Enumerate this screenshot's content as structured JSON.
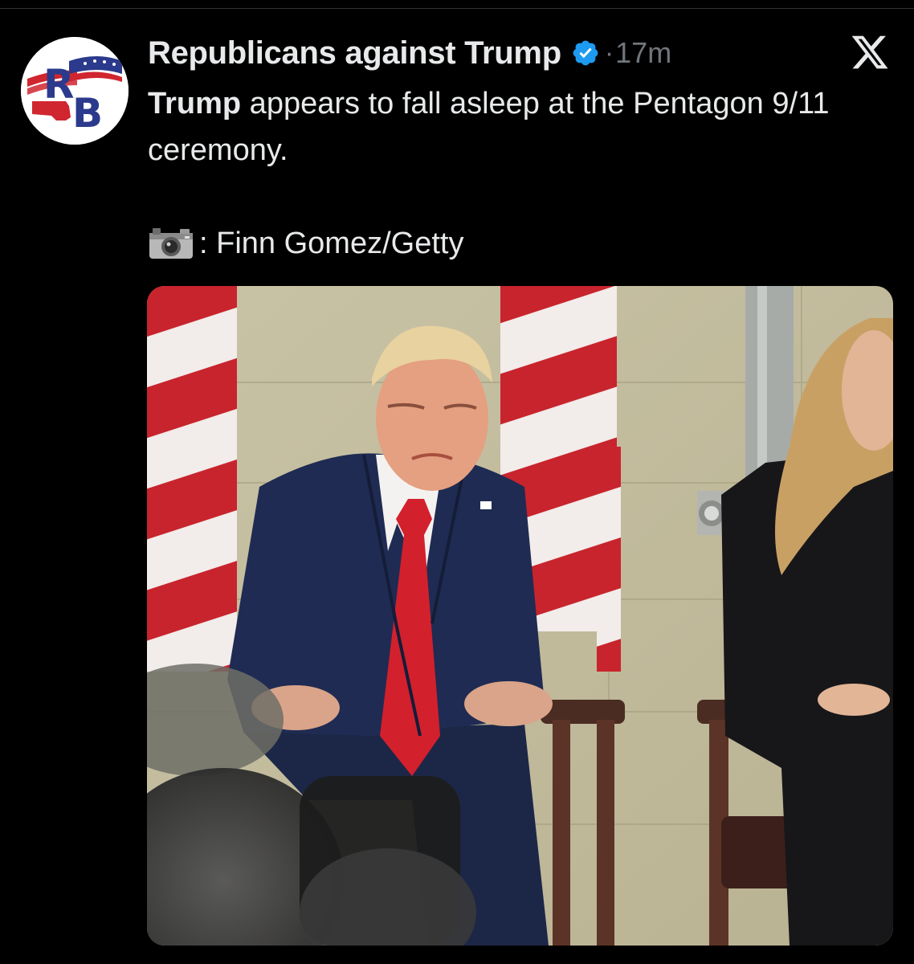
{
  "post": {
    "account_name": "Republicans against Trump",
    "avatar_initials": "RB",
    "separator": "·",
    "timestamp": "17m",
    "text_bold": "Trump",
    "text_rest": " appears to fall asleep at the Pentagon 9/11 ceremony.",
    "credit_text": ": Finn Gomez/Getty",
    "camera_icon": "camera-icon",
    "platform_icon": "x-logo-icon",
    "verified_icon": "verified-badge-icon"
  },
  "colors": {
    "background": "#000000",
    "text_primary": "#e7e9ea",
    "text_secondary": "#71767b",
    "verified_blue": "#1d9bf0",
    "brand_red": "#d0262f",
    "brand_blue": "#2b3a8c"
  }
}
